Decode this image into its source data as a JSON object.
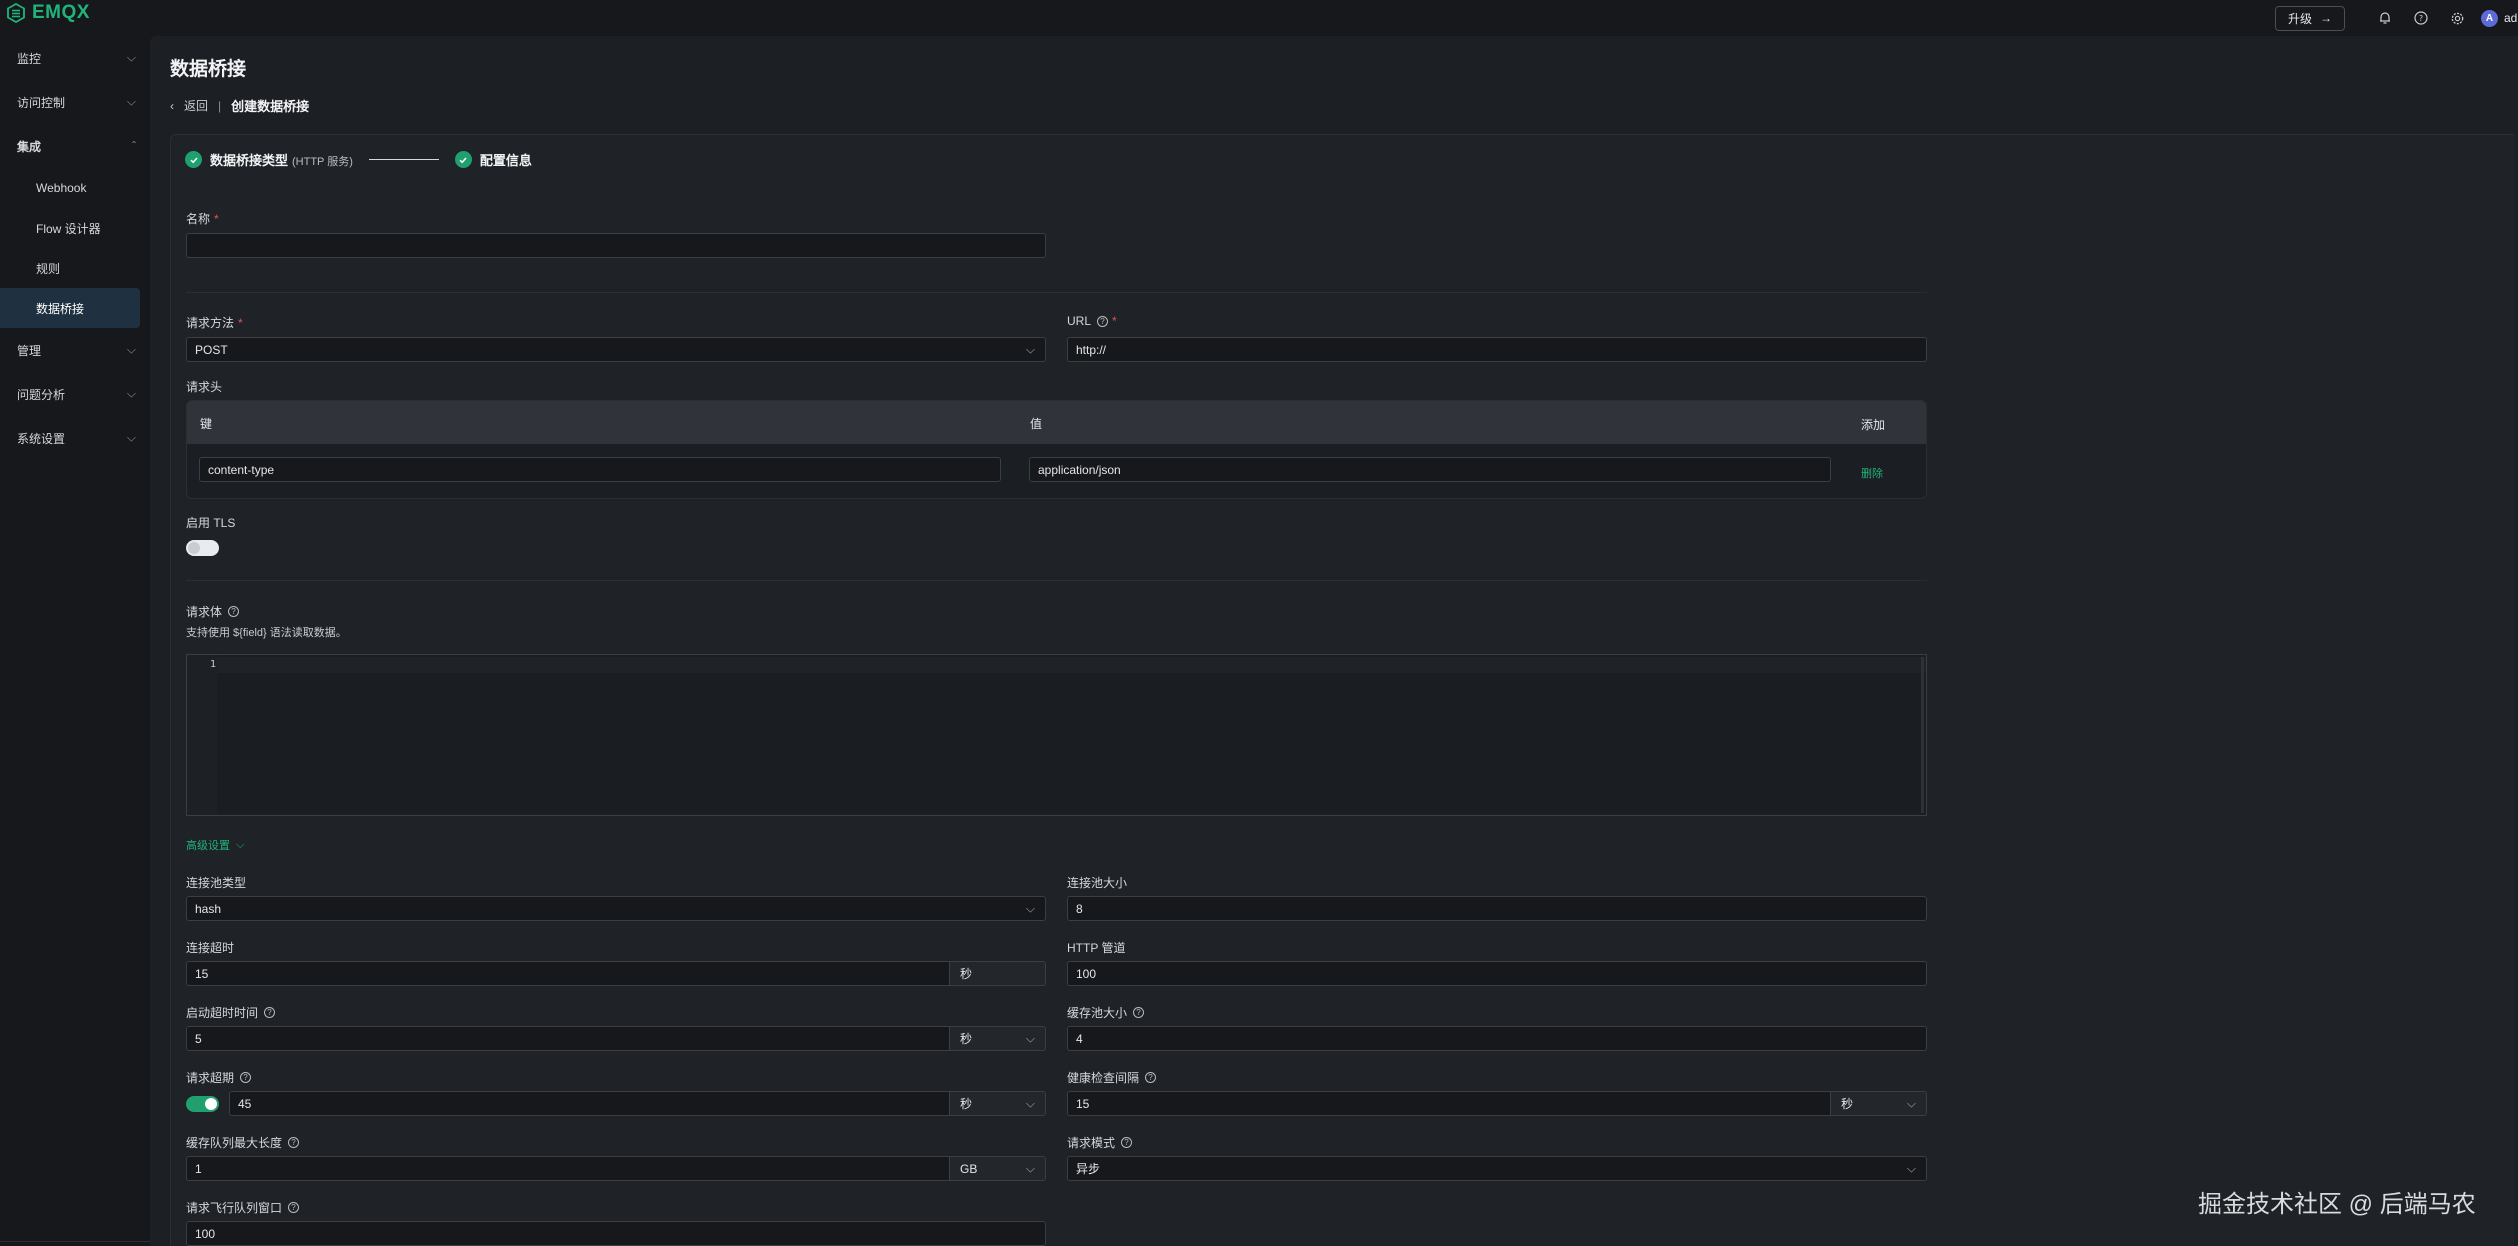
{
  "app": {
    "logo_text": "EMQX"
  },
  "topbar": {
    "upgrade_label": "升级",
    "icons": [
      "bell-icon",
      "help-circle-icon",
      "gear-icon"
    ],
    "avatar_letter": "A",
    "username": "admin"
  },
  "sidebar": {
    "items": [
      {
        "label": "监控",
        "expanded": false
      },
      {
        "label": "访问控制",
        "expanded": false
      },
      {
        "label": "集成",
        "expanded": true
      },
      {
        "label": "管理",
        "expanded": false
      },
      {
        "label": "问题分析",
        "expanded": false
      },
      {
        "label": "系统设置",
        "expanded": false
      }
    ],
    "sub_items": [
      "Webhook",
      "Flow 设计器",
      "规则",
      "数据桥接"
    ],
    "active_sub": "数据桥接"
  },
  "page": {
    "title": "数据桥接",
    "back_label": "返回",
    "current": "创建数据桥接"
  },
  "steps": {
    "step1_label": "数据桥接类型",
    "step1_sub": "(HTTP 服务)",
    "step2_label": "配置信息"
  },
  "form": {
    "name_label": "名称",
    "name_value": "",
    "method_label": "请求方法",
    "method_value": "POST",
    "url_label": "URL",
    "url_value": "http://",
    "headers_label": "请求头",
    "headers": {
      "key_col": "键",
      "value_col": "值",
      "add_label": "添加",
      "rows": [
        {
          "key": "content-type",
          "value": "application/json",
          "delete_label": "删除"
        }
      ]
    },
    "tls_label": "启用 TLS",
    "tls_enabled": false,
    "body_label": "请求体",
    "body_hint": "支持使用 ${field} 语法读取数据。",
    "body_line_number": "1",
    "advanced_label": "高级设置",
    "pool_type_label": "连接池类型",
    "pool_type_value": "hash",
    "pool_size_label": "连接池大小",
    "pool_size_value": "8",
    "connect_timeout_label": "连接超时",
    "connect_timeout_value": "15",
    "connect_timeout_unit": "秒",
    "http_pipeline_label": "HTTP 管道",
    "http_pipeline_value": "100",
    "start_timeout_label": "启动超时时间",
    "start_timeout_value": "5",
    "start_timeout_unit": "秒",
    "buffer_pool_label": "缓存池大小",
    "buffer_pool_value": "4",
    "request_ttl_label": "请求超期",
    "request_ttl_enabled": true,
    "request_ttl_value": "45",
    "request_ttl_unit": "秒",
    "health_check_label": "健康检查间隔",
    "health_check_value": "15",
    "health_check_unit": "秒",
    "queue_max_label": "缓存队列最大长度",
    "queue_max_value": "1",
    "queue_max_unit": "GB",
    "query_mode_label": "请求模式",
    "query_mode_value": "异步",
    "inflight_label": "请求飞行队列窗口",
    "inflight_value": "100"
  },
  "watermark": "掘金技术社区 @ 后端马农",
  "colors": {
    "accent": "#20b47a",
    "background": "#16181c",
    "panel": "#1f2226"
  }
}
